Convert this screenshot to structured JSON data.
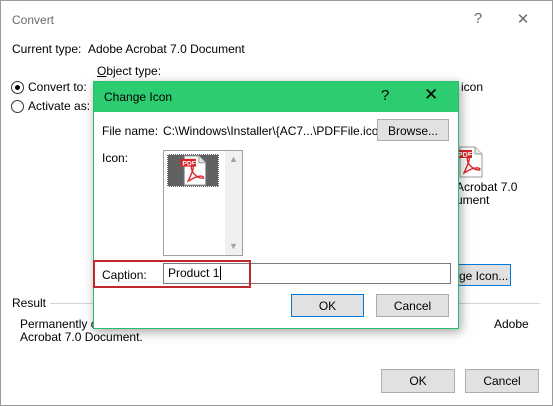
{
  "convert": {
    "title": "Convert",
    "help_glyph": "?",
    "close_glyph": "✕",
    "current_type_label": "Current type:",
    "current_type_value": "Adobe Acrobat 7.0 Document",
    "object_type_label": "Object type:",
    "convert_to_label": "Convert to:",
    "activate_as_label": "Activate as:",
    "selected_option": "convert_to",
    "display_as_icon_partial": "icon",
    "icon_caption_line1": "Acrobat 7.0",
    "icon_caption_line2": "ument",
    "change_icon_button_partial": "ge Icon...",
    "result_label": "Result",
    "result_text_line1_start": "Permanently chan",
    "result_text_line1_end": "Adobe",
    "result_text_line2": "Acrobat 7.0 Document.",
    "ok_label": "OK",
    "cancel_label": "Cancel"
  },
  "change_icon": {
    "title": "Change Icon",
    "help_glyph": "?",
    "close_glyph": "✕",
    "file_name_label": "File name:",
    "file_name_value": "C:\\Windows\\Installer\\{AC7...\\PDFFile.ico",
    "browse_label": "Browse...",
    "icon_label": "Icon:",
    "caption_label": "Caption:",
    "caption_value": "Product 1",
    "ok_label": "OK",
    "cancel_label": "Cancel"
  },
  "icons": {
    "pdf_badge": "PDF",
    "pdf_icon_name": "pdf-file-icon"
  },
  "colors": {
    "dialog_titlebar": "#2ecc71",
    "highlight_border": "#c0282c",
    "focus_border": "#0078d7",
    "pdf_red": "#d7262b"
  }
}
